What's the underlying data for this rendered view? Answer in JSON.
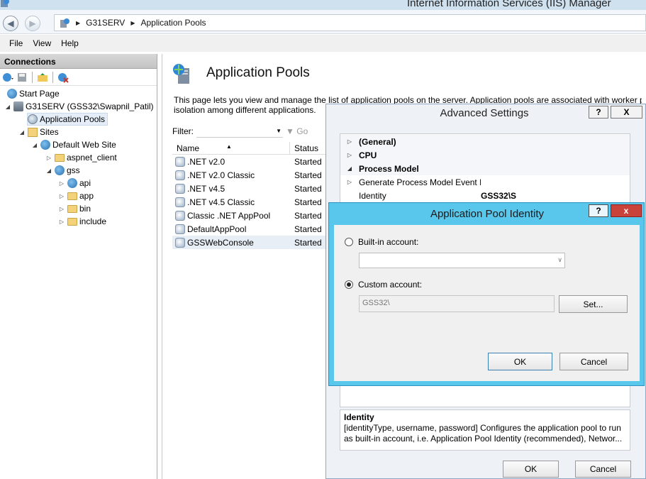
{
  "window": {
    "title": "Internet Information Services (IIS) Manager"
  },
  "address": {
    "crumbs": [
      "G31SERV",
      "Application Pools"
    ]
  },
  "menu": {
    "items": [
      "File",
      "View",
      "Help"
    ]
  },
  "connections": {
    "header": "Connections",
    "tree": {
      "start_page": "Start Page",
      "server": "G31SERV (GSS32\\Swapnil_Patil)",
      "app_pools": "Application Pools",
      "sites": "Sites",
      "default_site": "Default Web Site",
      "aspnet_client": "aspnet_client",
      "gss": "gss",
      "api": "api",
      "app": "app",
      "bin": "bin",
      "include": "include"
    }
  },
  "main": {
    "title": "Application Pools",
    "description_line1": "This page lets you view and manage the list of application pools on the server. Application pools are associated with worker pro",
    "description_line2": "isolation among different applications.",
    "filter_label": "Filter:",
    "go_label": "Go",
    "columns": {
      "name": "Name",
      "status": "Status"
    },
    "pools": [
      {
        "name": ".NET v2.0",
        "status": "Started"
      },
      {
        "name": ".NET v2.0 Classic",
        "status": "Started"
      },
      {
        "name": ".NET v4.5",
        "status": "Started"
      },
      {
        "name": ".NET v4.5 Classic",
        "status": "Started"
      },
      {
        "name": "Classic .NET AppPool",
        "status": "Started"
      },
      {
        "name": "DefaultAppPool",
        "status": "Started"
      },
      {
        "name": "GSSWebConsole",
        "status": "Started"
      }
    ]
  },
  "advanced": {
    "title": "Advanced Settings",
    "help": "?",
    "close": "X",
    "rows": {
      "general": "(General)",
      "cpu": "CPU",
      "process_model": "Process Model",
      "generate_event": "Generate Process Model Event L",
      "identity_name": "Identity",
      "identity_value": "GSS32\\S"
    },
    "desc_title": "Identity",
    "desc_line1": "[identityType, username, password] Configures the application pool to run",
    "desc_line2": "as built-in account, i.e. Application Pool Identity (recommended), Networ...",
    "ok": "OK",
    "cancel": "Cancel"
  },
  "identity_dialog": {
    "title": "Application Pool Identity",
    "help": "?",
    "close": "x",
    "builtin_label": "Built-in account:",
    "custom_label": "Custom account:",
    "custom_value": "GSS32\\",
    "set": "Set...",
    "ok": "OK",
    "cancel": "Cancel"
  }
}
